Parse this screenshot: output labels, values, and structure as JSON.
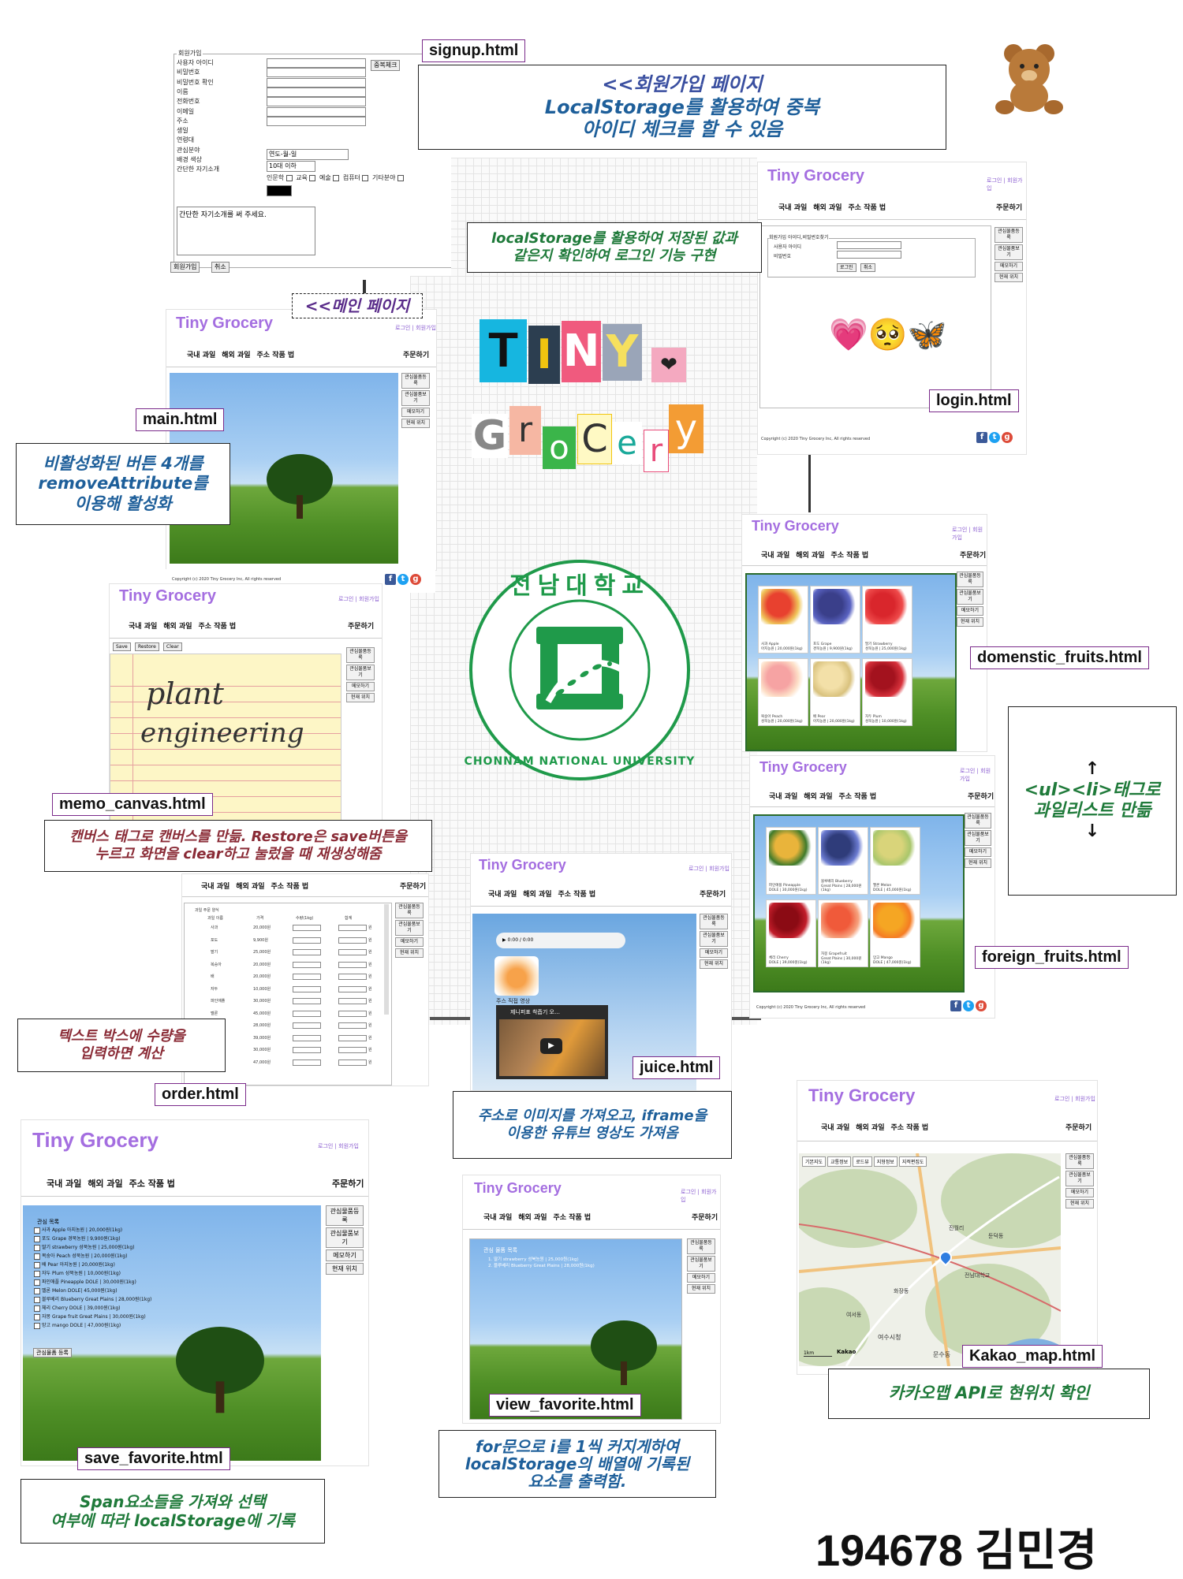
{
  "brand": "Tiny Grocery",
  "login_links": "로그인 | 회원가입",
  "nav": [
    "국내 과일",
    "해외 과일",
    "주소 작품 법"
  ],
  "order_label": "주문하기",
  "side_buttons": [
    "관심물품등록",
    "관심물품보기",
    "메모하기",
    "현재 위치"
  ],
  "copyright": "Copyright (c) 2020 Tiny Grocery Inc, All rights reserved",
  "social_icons": [
    "facebook-icon",
    "twitter-icon",
    "google-plus-icon"
  ],
  "signup": {
    "legend": "회원가입",
    "fields": [
      "사용자 아이디",
      "비밀번호",
      "비밀번호 확인",
      "이름",
      "전화번호",
      "이메일",
      "주소",
      "생일",
      "연령대",
      "관심분야",
      "배경 색상",
      "간단한 자기소개"
    ],
    "dup_check": "중복체크",
    "birthday_placeholder": "연도-월-일",
    "age_value": "10대 이하",
    "interests": [
      "인문학",
      "교육",
      "예술",
      "컴퓨터",
      "기타분야"
    ],
    "intro_placeholder": "간단한 자기소개를 써 주세요.",
    "submit": "회원가입",
    "cancel": "취소"
  },
  "login_form": {
    "legend": "회원가입 아이디,비밀번호찾기",
    "id_label": "사용자 아이디",
    "pw_label": "비밀번호",
    "login_btn": "로그인",
    "cancel_btn": "취소",
    "emoji": "💗🥺🦋"
  },
  "memo": {
    "buttons": [
      "Save",
      "Restore",
      "Clear"
    ],
    "handwriting_1": "plant",
    "handwriting_2": "engineering"
  },
  "order_page": {
    "title": "과일 주문 양식",
    "headers": [
      "과일 이름",
      "가격",
      "수량(1kg)",
      "합계"
    ],
    "rows": [
      [
        "사과",
        "20,000원"
      ],
      [
        "포도",
        "9,900원"
      ],
      [
        "딸기",
        "25,000원"
      ],
      [
        "복숭아",
        "20,000원"
      ],
      [
        "배",
        "20,000원"
      ],
      [
        "자두",
        "10,000원"
      ],
      [
        "파인애플",
        "30,000원"
      ],
      [
        "멜론",
        "45,000원"
      ],
      [
        "블루베리",
        "28,000원"
      ],
      [
        "체리",
        "39,000원"
      ],
      [
        "자몽",
        "30,000원"
      ],
      [
        "망고",
        "47,000원"
      ]
    ],
    "unit": "원",
    "total_label": "합계"
  },
  "domestic_fruits": [
    {
      "name": "사과 Apple",
      "price": "아지농원 | 20,000원(1kg)"
    },
    {
      "name": "포도 Grape",
      "price": "경북농원 | 9,900원(1kg)"
    },
    {
      "name": "딸기 Strawberry",
      "price": "성북농원 | 25,000원(1kg)"
    },
    {
      "name": "복숭아 Peach",
      "price": "성북농원 | 20,000원(1kg)"
    },
    {
      "name": "배 Pear",
      "price": "아지농원 | 20,000원(1kg)"
    },
    {
      "name": "자두 Plum",
      "price": "성북농원 | 10,000원(1kg)"
    }
  ],
  "foreign_fruits": [
    {
      "name": "파인애플 Pineapple",
      "price": "DOLE | 30,000원(1kg)"
    },
    {
      "name": "블루베리 Blueberry",
      "price": "Great Plains | 28,000원(1kg)"
    },
    {
      "name": "멜론 Melon",
      "price": "DOLE | 45,000원(1kg)"
    },
    {
      "name": "체리 Cherry",
      "price": "DOLE | 39,000원(1kg)"
    },
    {
      "name": "자몽 Grapefruit",
      "price": "Great Plains | 30,000원(1kg)"
    },
    {
      "name": "망고 Mango",
      "price": "DOLE | 47,000원(1kg)"
    }
  ],
  "juice": {
    "audio_time": "0:00 / 0:00",
    "video_caption": "주스 직접 영상",
    "video_title": "제니퍼표 착즙기 오…"
  },
  "save_favorite": {
    "list_title": "관심 목록",
    "items": [
      "사과 Apple 아지농원 | 20,000원(1kg)",
      "포도 Grape 경북농원 | 9,900원(1kg)",
      "딸기 strawberry 성북농원 | 25,000원(1kg)",
      "복숭아 Peach 성북농원 | 20,000원(1kg)",
      "배 Pear 아지농원 | 20,000원(1kg)",
      "자두 Plum 성북농원 | 10,000원(1kg)",
      "파인애플 Pineapple DOLE | 30,000원(1kg)",
      "멜론 Melon DOLE| 45,000원(1kg)",
      "블루베리 Blueberry Great Plains | 28,000원(1kg)",
      "체리 Cherry DOLE | 39,000원(1kg)",
      "자몽 Grape fruit Great Plains | 30,000원(1kg)",
      "망고 mango DOLE | 47,000원(1kg)"
    ],
    "register_btn": "관심물품 등록"
  },
  "view_favorite": {
    "list_title": "관심 물품 목록",
    "items": [
      "1. 딸기 strawberry 성북농원 | 25,000원(1kg)",
      "2. 블루베리 Blueberry Great Plains | 28,000원(1kg)"
    ]
  },
  "map": {
    "buttons": [
      "기본지도",
      "교통정보",
      "로드뷰",
      "지형정보",
      "지적편집도"
    ],
    "scale": "1km",
    "logo": "Kakao",
    "places": [
      "진월리",
      "전남대학교",
      "여수시청",
      "여서동",
      "문수동",
      "화장동",
      "둔덕동"
    ]
  },
  "labels": {
    "signup": "signup.html",
    "main": "main.html",
    "login": "login.html",
    "memo_canvas": "memo_canvas.html",
    "domestic": "domenstic_fruits.html",
    "foreign": "foreign_fruits.html",
    "juice": "juice.html",
    "order": "order.html",
    "save_favorite": "save_favorite.html",
    "view_favorite": "view_favorite.html",
    "kakao_map": "Kakao_map.html"
  },
  "notes": {
    "signup": [
      "<<회원가입 페이지",
      "LocalStorage를 활용하여 중복",
      "아이디 체크를 할 수 있음"
    ],
    "login": [
      "localStorage를 활용하여 저장된 값과",
      "같은지 확인하여 로그인 기능 구현"
    ],
    "main_tag": "<<메인 페이지",
    "main": [
      "비활성화된 버튼 4개를",
      "removeAttribute를",
      "이용해 활성화"
    ],
    "memo": [
      "캔버스 태그로 캔버스를 만듦. Restore은 save버튼을",
      "누르고 화면을 clear하고 눌렀을 때 재생성해줌"
    ],
    "fruits": [
      "↑",
      "<ul><li>태그로",
      "과일리스트 만듦",
      "↓"
    ],
    "order": [
      "텍스트 박스에 수량을",
      "입력하면 계산"
    ],
    "juice": [
      "주소로 이미지를 가져오고, iframe을",
      "이용한 유튜브 영상도 가져옴"
    ],
    "map": "카카오맵 API로 현위치 확인",
    "view_favorite": [
      "for문으로 i를 1씩 커지게하여",
      "localStorage의 배열에 기록된",
      "요소를 출력함."
    ],
    "save_favorite": [
      "Span요소들을 가져와 선택",
      "여부에 따라 localStorage에 기록"
    ]
  },
  "logo_letters": {
    "tiny": [
      "T",
      "I",
      "N",
      "Y"
    ],
    "grocery": [
      "G",
      "r",
      "o",
      "C",
      "e",
      "r",
      "y"
    ]
  },
  "university": {
    "korean": "전남대학교",
    "english": "CHONNAM NATIONAL UNIVERSITY"
  },
  "author": "194678 김민경",
  "colors": {
    "brand_purple": "#a46ee0",
    "cnu_green": "#1f9a4a",
    "label_border": "#7a2a8a"
  }
}
